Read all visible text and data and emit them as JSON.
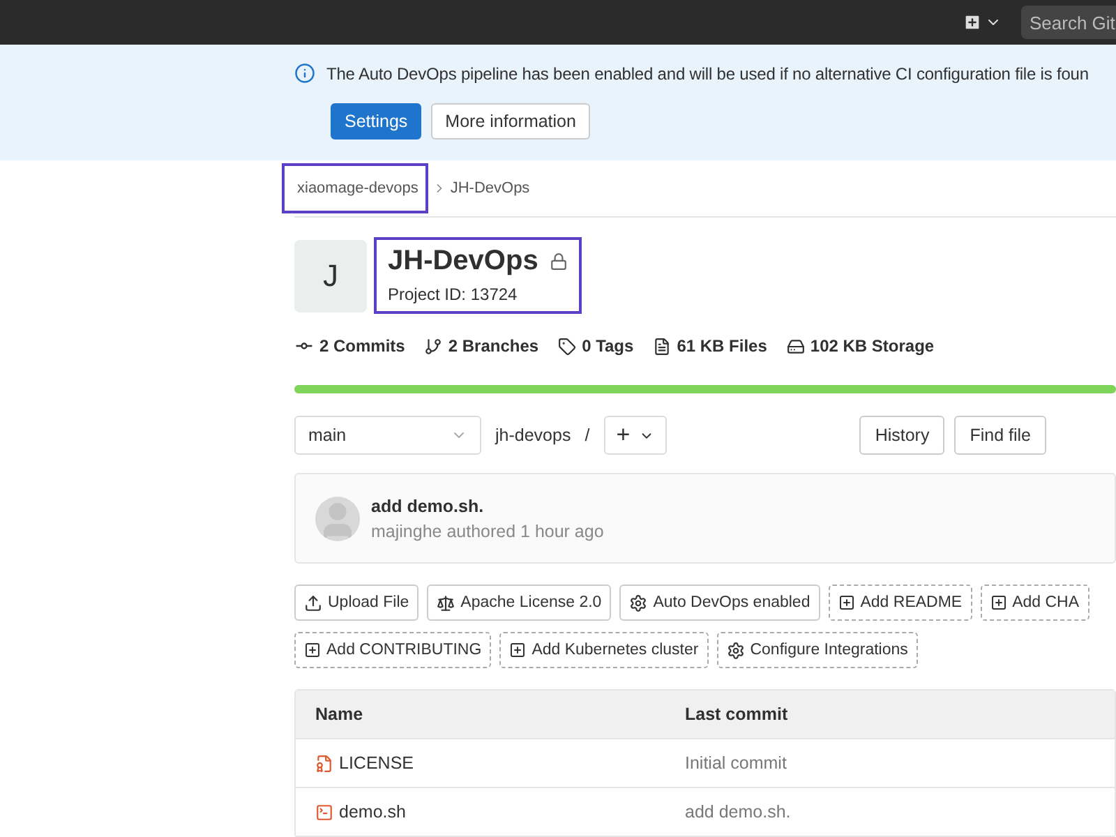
{
  "top_bar": {
    "search": {
      "placeholder": "Search Git"
    }
  },
  "banner": {
    "message": "The Auto DevOps pipeline has been enabled and will be used if no alternative CI configuration file is foun",
    "buttons": [
      {
        "label": "Settings",
        "kind": "primary"
      },
      {
        "label": "More information",
        "kind": "default"
      }
    ]
  },
  "breadcrumb": [
    {
      "label": "xiaomage-devops",
      "highlighted": true
    },
    {
      "label": "JH-DevOps",
      "highlighted": false
    }
  ],
  "project": {
    "avatar_letter": "J",
    "name": "JH-DevOps",
    "project_id": "Project ID: 13724",
    "highlighted": true
  },
  "stats": [
    {
      "kind": "commit",
      "label": "2 Commits"
    },
    {
      "kind": "branch",
      "label": "2 Branches"
    },
    {
      "kind": "tag",
      "label": "0 Tags"
    },
    {
      "kind": "file",
      "label": "61 KB Files"
    },
    {
      "kind": "storage",
      "label": "102 KB Storage"
    }
  ],
  "language_bar": {
    "level": 1
  },
  "repo_bar": {
    "branch": "main",
    "path": "jh-devops",
    "separator": "/",
    "add": "+",
    "buttons": [
      "History",
      "Find file"
    ]
  },
  "last_commit": {
    "title": "add demo.sh.",
    "meta": "majinghe authored 1 hour ago"
  },
  "actions": [
    {
      "label": "Upload File",
      "kind": "upload",
      "dashed": false
    },
    {
      "label": "Apache License 2.0",
      "kind": "license",
      "dashed": false
    },
    {
      "label": "Auto DevOps enabled",
      "kind": "gear",
      "dashed": false
    },
    {
      "label": "Add README",
      "kind": "add",
      "dashed": true
    },
    {
      "label": "Add CHA",
      "kind": "add",
      "dashed": true
    },
    {
      "label": "Add CONTRIBUTING",
      "kind": "add",
      "dashed": true
    },
    {
      "label": "Add Kubernetes cluster",
      "kind": "add",
      "dashed": true
    },
    {
      "label": "Configure Integrations",
      "kind": "gear",
      "dashed": true
    }
  ],
  "table": {
    "columns": [
      "Name",
      "Last commit"
    ],
    "rows": [
      {
        "name": "LICENSE",
        "kind": "license",
        "last_commit": "Initial commit"
      },
      {
        "name": "demo.sh",
        "kind": "script",
        "last_commit": "add demo.sh."
      }
    ]
  }
}
